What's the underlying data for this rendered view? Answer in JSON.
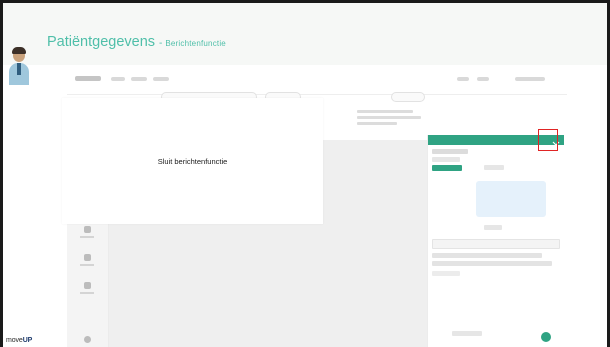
{
  "slide": {
    "title": "Patiëntgegevens",
    "separator": "-",
    "subtitle": "Berichtenfunctie"
  },
  "modal": {
    "text": "Sluit berichtenfunctie"
  },
  "brand": {
    "prefix": "move",
    "suffix": "UP"
  },
  "colors": {
    "accent": "#4fbfa9",
    "panel_header": "#2fa383",
    "highlight": "#e02424"
  },
  "icons": {
    "presenter": "doctor-avatar-icon",
    "close_messages": "close-icon"
  }
}
